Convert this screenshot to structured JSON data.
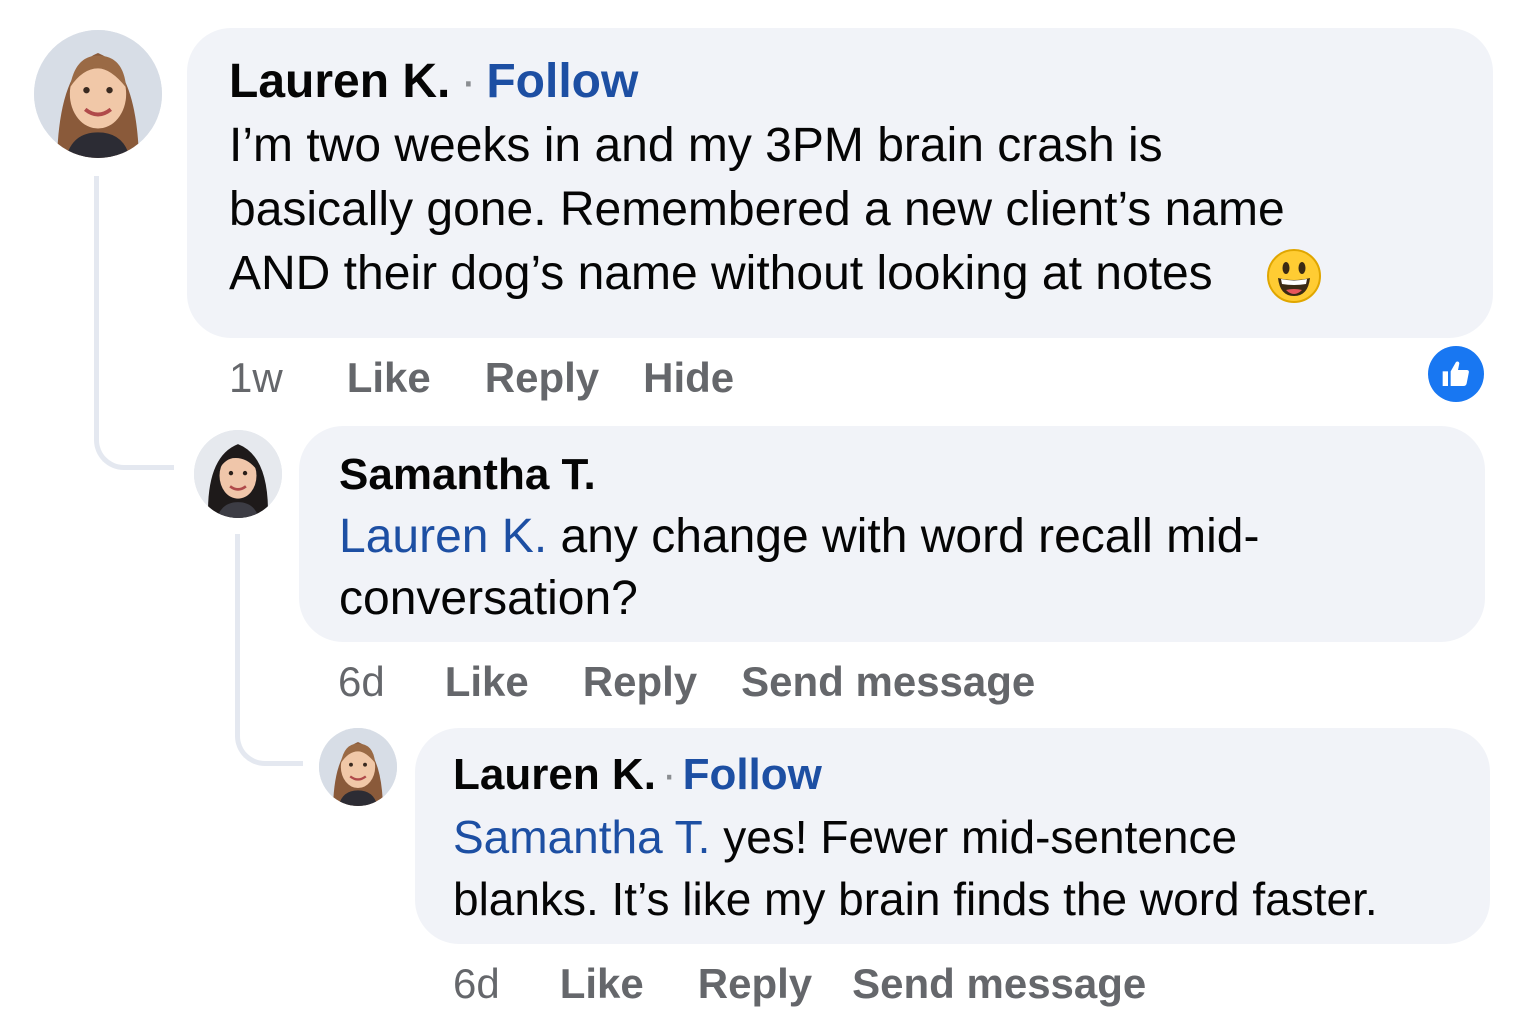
{
  "comments": [
    {
      "author": "Lauren K.",
      "follow_label": "Follow",
      "text_lines": [
        "I’m two weeks in and my 3PM brain crash is",
        "basically gone. Remembered a new client’s name",
        "AND their dog’s name without looking at notes"
      ],
      "emoji": "grinning-face",
      "time": "1w",
      "actions": [
        "Like",
        "Reply",
        "Hide"
      ],
      "reaction": "like",
      "colors": {
        "reaction_badge": "#1877f2"
      }
    },
    {
      "author": "Samantha T.",
      "mention": "Lauren K.",
      "text_first": " any change with word recall mid-",
      "text_second": "conversation?",
      "time": "6d",
      "actions": [
        "Like",
        "Reply",
        "Send message"
      ]
    },
    {
      "author": "Lauren K.",
      "follow_label": "Follow",
      "mention": "Samantha T.",
      "text_first": " yes! Fewer mid-sentence",
      "text_second": "blanks. It’s like my brain finds the word faster.",
      "time": "6d",
      "actions": [
        "Like",
        "Reply",
        "Send message"
      ]
    }
  ],
  "colors": {
    "bubble": "#f1f3f8",
    "link_blue": "#1d4fa3",
    "meta_gray": "#65676b",
    "thread_line": "#e4e8f0"
  }
}
